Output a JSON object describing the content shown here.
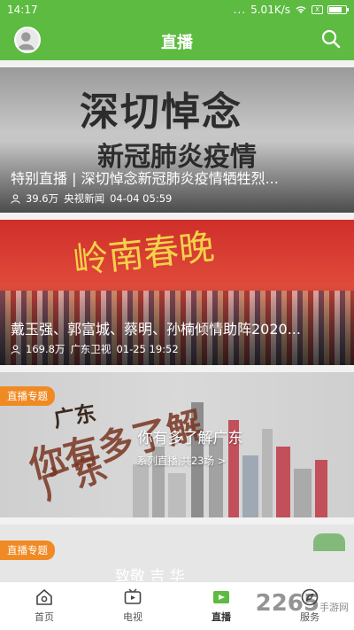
{
  "status_bar": {
    "time": "14:17",
    "signal": "...",
    "speed": "5.01K/s",
    "sim_label": "X"
  },
  "header": {
    "title": "直播"
  },
  "cards": [
    {
      "poster_text": "深切悼念",
      "poster_subtext": "新冠肺炎疫情",
      "title": "特别直播 | 深切悼念新冠肺炎疫情牺牲烈...",
      "views": "39.6万",
      "channel": "央视新闻",
      "datetime": "04-04 05:59"
    },
    {
      "poster_text": "岭南春晚",
      "title": "戴玉强、郭富城、蔡明、孙楠倾情助阵2020...",
      "views": "169.8万",
      "channel": "广东卫视",
      "datetime": "01-25 19:52"
    }
  ],
  "topic_cards": [
    {
      "badge": "直播专题",
      "brush_small": "广东",
      "brush_line1": "你有多了解",
      "brush_line2": "广东",
      "title": "你有多了解广东",
      "subtitle": "系列直播,共23场 >"
    },
    {
      "badge": "直播专题",
      "title_partial": "致敬 吉 华"
    }
  ],
  "bottom_nav": [
    {
      "label": "首页",
      "icon": "home-icon"
    },
    {
      "label": "电视",
      "icon": "tv-icon"
    },
    {
      "label": "直播",
      "icon": "live-icon",
      "active": true
    },
    {
      "label": "服务",
      "icon": "compass-icon"
    }
  ],
  "watermark": {
    "text": "2265",
    "sub": "手游网"
  },
  "colors": {
    "brand_green": "#5dbb41",
    "badge_orange": "#f08a24"
  }
}
